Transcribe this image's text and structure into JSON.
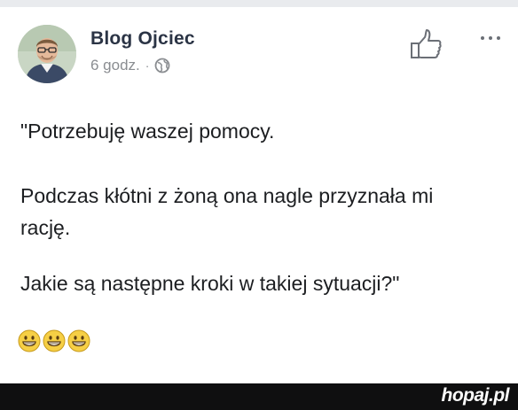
{
  "post": {
    "author": "Blog Ojciec",
    "timestamp": "6 godz.",
    "separator": "·",
    "privacy_icon": "globe-icon",
    "paragraphs": [
      "\"Potrzebuję waszej pomocy.",
      "Podczas kłótni z żoną ona nagle przyznała mi",
      "rację.",
      "Jakie są następne kroki w takiej sytuacji?\""
    ],
    "emojis": [
      "grinning-face-icon",
      "grinning-face-icon",
      "grinning-face-icon"
    ]
  },
  "actions": {
    "like_icon": "thumbs-up-icon",
    "more_icon": "more-options-icon"
  },
  "watermark": "hopaj.pl",
  "colors": {
    "author": "#2b3445",
    "meta": "#8a8d91",
    "text": "#1c1e21",
    "footer": "#0f0f10"
  }
}
